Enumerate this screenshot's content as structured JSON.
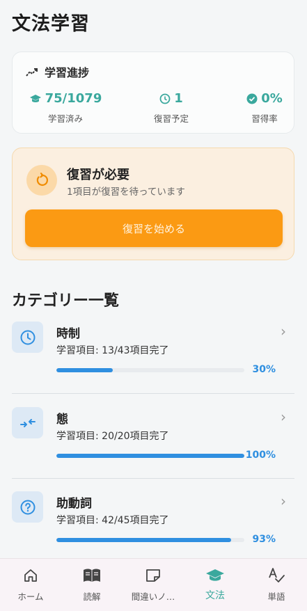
{
  "page": {
    "title": "文法学習"
  },
  "progress": {
    "header": "学習進捗",
    "stats": [
      {
        "value": "75/1079",
        "caption": "学習済み",
        "icon": "graduation-cap-icon"
      },
      {
        "value": "1",
        "caption": "復習予定",
        "icon": "clock-icon"
      },
      {
        "value": "0%",
        "caption": "習得率",
        "icon": "check-badge-icon"
      }
    ]
  },
  "review": {
    "title": "復習が必要",
    "subtitle": "1項目が復習を待っています",
    "button": "復習を始める"
  },
  "categories_title": "カテゴリー一覧",
  "categories": [
    {
      "name": "時制",
      "progress_text": "学習項目: 13/43項目完了",
      "percent": "30%",
      "fraction": 0.3,
      "icon": "clock-icon"
    },
    {
      "name": "態",
      "progress_text": "学習項目: 20/20項目完了",
      "percent": "100%",
      "fraction": 1.0,
      "icon": "swap-arrows-icon"
    },
    {
      "name": "助動詞",
      "progress_text": "学習項目: 42/45項目完了",
      "percent": "93%",
      "fraction": 0.93,
      "icon": "help-circle-icon"
    }
  ],
  "nav": [
    {
      "label": "ホーム",
      "icon": "home-icon"
    },
    {
      "label": "読解",
      "icon": "book-icon"
    },
    {
      "label": "間違いノ…",
      "icon": "note-icon"
    },
    {
      "label": "文法",
      "icon": "graduation-cap-icon",
      "active": true
    },
    {
      "label": "単語",
      "icon": "spell-check-icon"
    }
  ],
  "colors": {
    "accent": "#3aa89d",
    "orange": "#fb9a13",
    "blue": "#2f8fe0"
  }
}
